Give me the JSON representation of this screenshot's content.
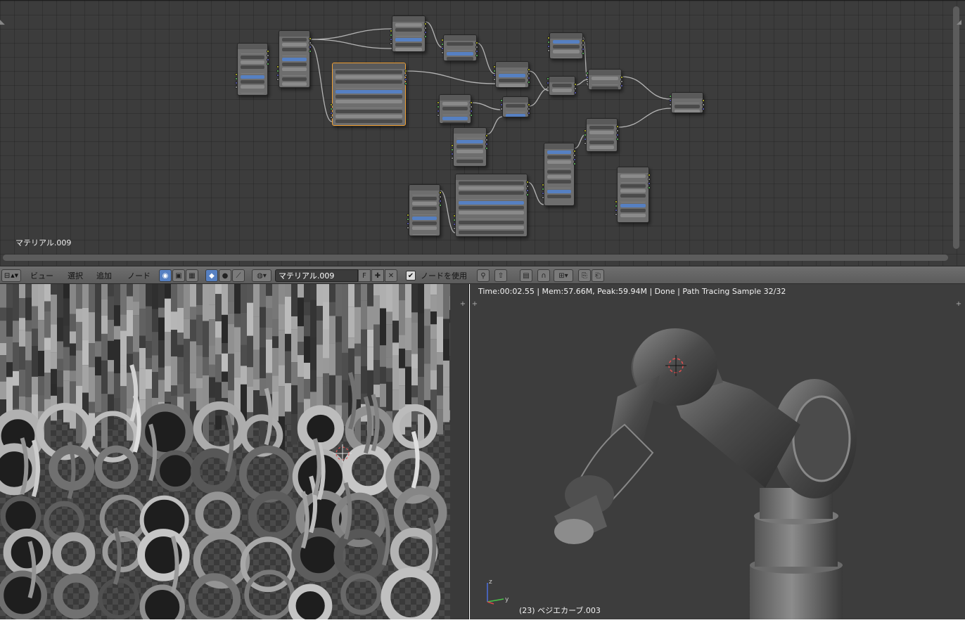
{
  "node_editor": {
    "material_label": "マテリアル.009"
  },
  "header": {
    "menus": [
      "ビュー",
      "選択",
      "追加",
      "ノード"
    ],
    "material_name": "マテリアル.009",
    "fake_user_label": "F",
    "use_nodes_label": "ノードを使用",
    "use_nodes_checked": true
  },
  "viewport": {
    "render_info": "Time:00:02.55 | Mem:57.66M, Peak:59.94M | Done | Path Tracing Sample 32/32",
    "object_label": "(23) ベジエカーブ.003",
    "axis_z": "z",
    "axis_y": "y"
  },
  "colors": {
    "node_bg": "#6e6e6e",
    "active_node_border": "#f0a032",
    "socket_color_yellow": "#c7c729",
    "socket_color_gray": "#a1a1a1",
    "socket_color_blue": "#6363c7",
    "socket_color_green": "#63c763",
    "selected_blue": "#5680c2"
  },
  "icons": {
    "editor_type": "node-editor-icon",
    "render_engine": "material-sphere-icon",
    "add": "plus-icon",
    "remove": "x-icon",
    "pin": "pin-icon",
    "parent": "parent-node-icon",
    "backdrop": "backdrop-icon",
    "snap": "snap-icon",
    "copy": "copy-icon",
    "paste": "paste-icon"
  }
}
